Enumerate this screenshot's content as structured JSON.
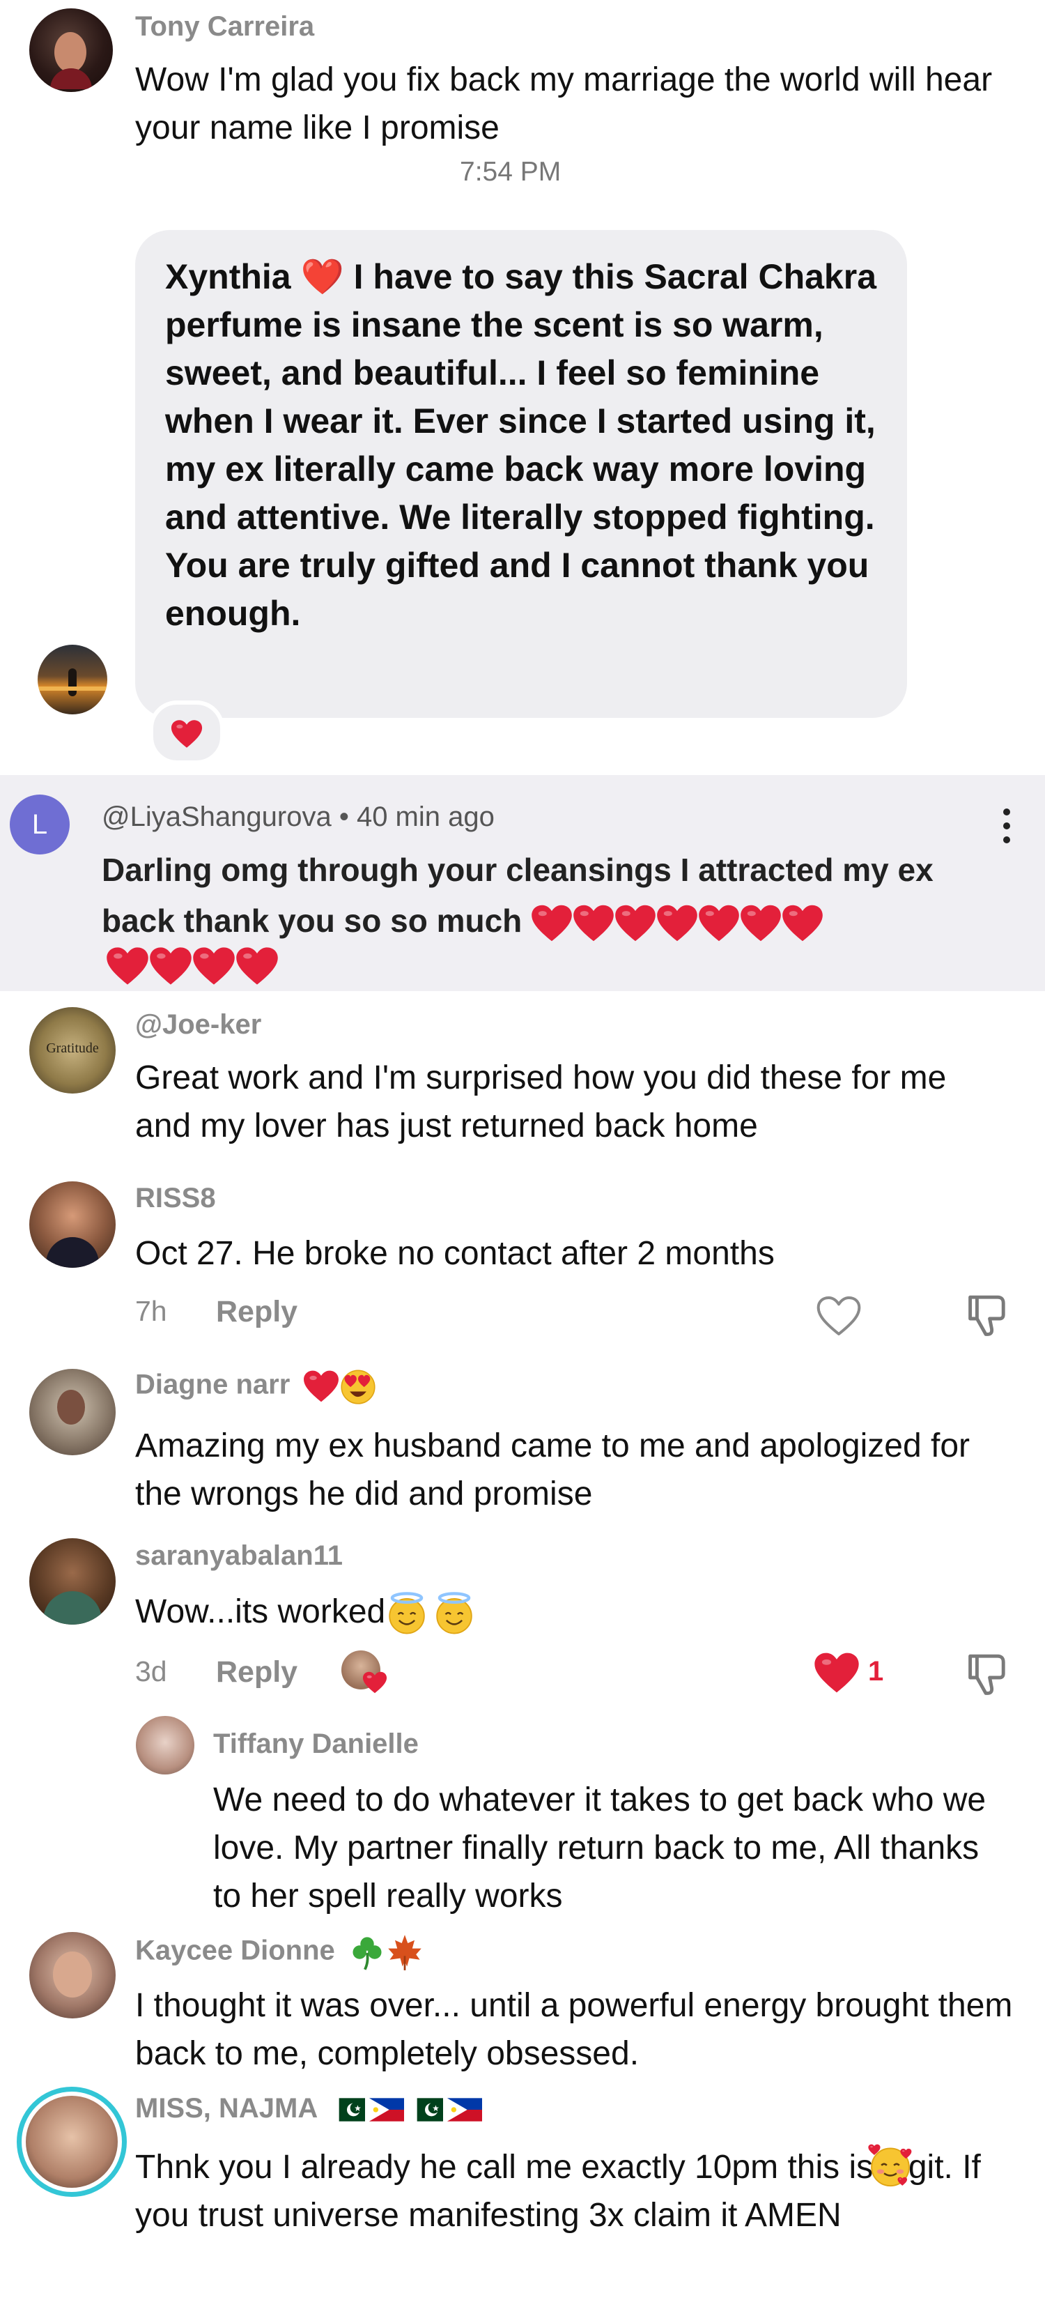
{
  "comments": [
    {
      "name": "Tony Carreira",
      "text": "Wow I'm glad you fix back my marriage the world will hear your name like I promise",
      "time": "7:54 PM"
    },
    {
      "bubble_text": "Xynthia ❤️ I have to say this Sacral Chakra perfume is insane the scent is so warm, sweet, and beautiful... I feel so feminine when I wear it. Ever since I started using it, my ex literally came back way more loving and attentive. We literally stopped fighting. You are truly gifted and I cannot thank you enough."
    },
    {
      "avatar_letter": "L",
      "handle": "@LiyaShangurova",
      "time": "40 min ago",
      "text": "Darling omg through your cleansings I attracted my ex back thank you so so much"
    },
    {
      "avatar_text": "Gratitude",
      "name": "@Joe-ker",
      "text": "Great work and I'm surprised how you did these for me and my lover has just returned back home"
    },
    {
      "name": "RISS8",
      "text": "Oct 27. He broke no contact after 2 months",
      "time": "7h",
      "reply": "Reply"
    },
    {
      "name": "Diagne narr",
      "text": "Amazing my ex husband came to me and apologized for the wrongs he did and promise"
    },
    {
      "name": "saranyabalan11",
      "text": "Wow...its worked",
      "time": "3d",
      "reply": "Reply",
      "likes": "1"
    },
    {
      "name": "Tiffany Danielle",
      "text": "We need to do whatever it takes to get back who we love. My partner finally return back to me, All thanks to her spell really works"
    },
    {
      "name": "Kaycee Dionne",
      "text": "I thought it was over... until a powerful energy brought them back to me, completely obsessed."
    },
    {
      "name": "MISS, NAJMA",
      "text": "Thnk you I already he call me exactly 10pm this is legit. If you trust universe manifesting 3x claim it AMEN"
    }
  ],
  "colors": {
    "heart": "#e3203a",
    "secondary_text": "#8a8a8a",
    "bubble": "#eeeef1",
    "liya_bg": "#f0eff3",
    "liya_avatar": "#6f6ed3"
  },
  "icons": [
    "heart-icon",
    "like-heart-outline-icon",
    "dislike-icon",
    "more-options-icon",
    "shamrock-icon",
    "maple-leaf-icon",
    "halo-face-icon",
    "heart-eyes-face-icon",
    "smiling-face-hearts-icon",
    "pakistan-flag-icon",
    "philippines-flag-icon"
  ]
}
